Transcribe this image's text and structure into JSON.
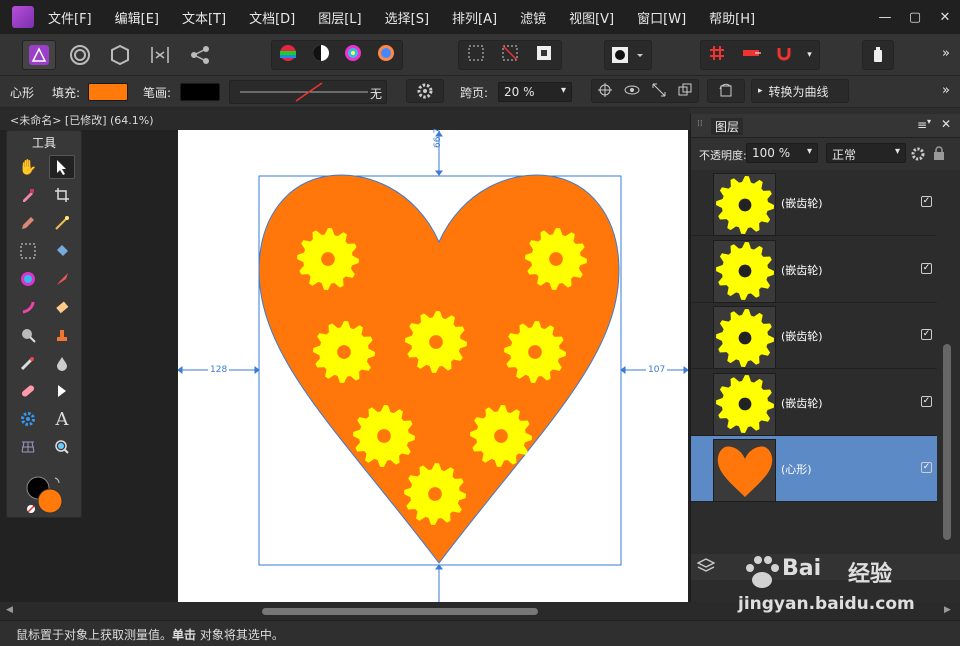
{
  "menubar": {
    "items": [
      "文件[F]",
      "编辑[E]",
      "文本[T]",
      "文档[D]",
      "图层[L]",
      "选择[S]",
      "排列[A]",
      "滤镜",
      "视图[V]",
      "窗口[W]",
      "帮助[H]"
    ]
  },
  "toolbar": {
    "more_label": "»"
  },
  "context": {
    "shape_label": "心形",
    "fill_label": "填充:",
    "fill_color": "#ff7a0a",
    "stroke_label": "笔画:",
    "stroke_color": "#000000",
    "stroke_width_text": "无",
    "span_label": "跨页:",
    "zoom": "20 %",
    "convert_label": "转换为曲线",
    "more_label": "»"
  },
  "doc": {
    "tab_title": "<未命名> [已修改] (64.1%)"
  },
  "tools": {
    "title": "工具"
  },
  "canvas": {
    "dim_top": "66.7",
    "dim_left": "128",
    "dim_right": "107",
    "heart_color": "#ff770a",
    "gear_color": "#ffff00"
  },
  "layers": {
    "title": "图层",
    "opacity_label": "不透明度:",
    "opacity_value": "100 %",
    "blend_mode": "正常",
    "items": [
      {
        "name": "(嵌齿轮)",
        "checked": true
      },
      {
        "name": "(嵌齿轮)",
        "checked": true
      },
      {
        "name": "(嵌齿轮)",
        "checked": true
      },
      {
        "name": "(嵌齿轮)",
        "checked": true
      },
      {
        "name": "(心形)",
        "checked": true
      }
    ]
  },
  "status": {
    "text_before": "鼠标置于对象上获取测量值。",
    "text_bold": "单击",
    "text_after": " 对象将其选中。"
  },
  "watermark": {
    "brand": "Bai",
    "brand_cn": "经验",
    "url": "jingyan.baidu.com"
  }
}
